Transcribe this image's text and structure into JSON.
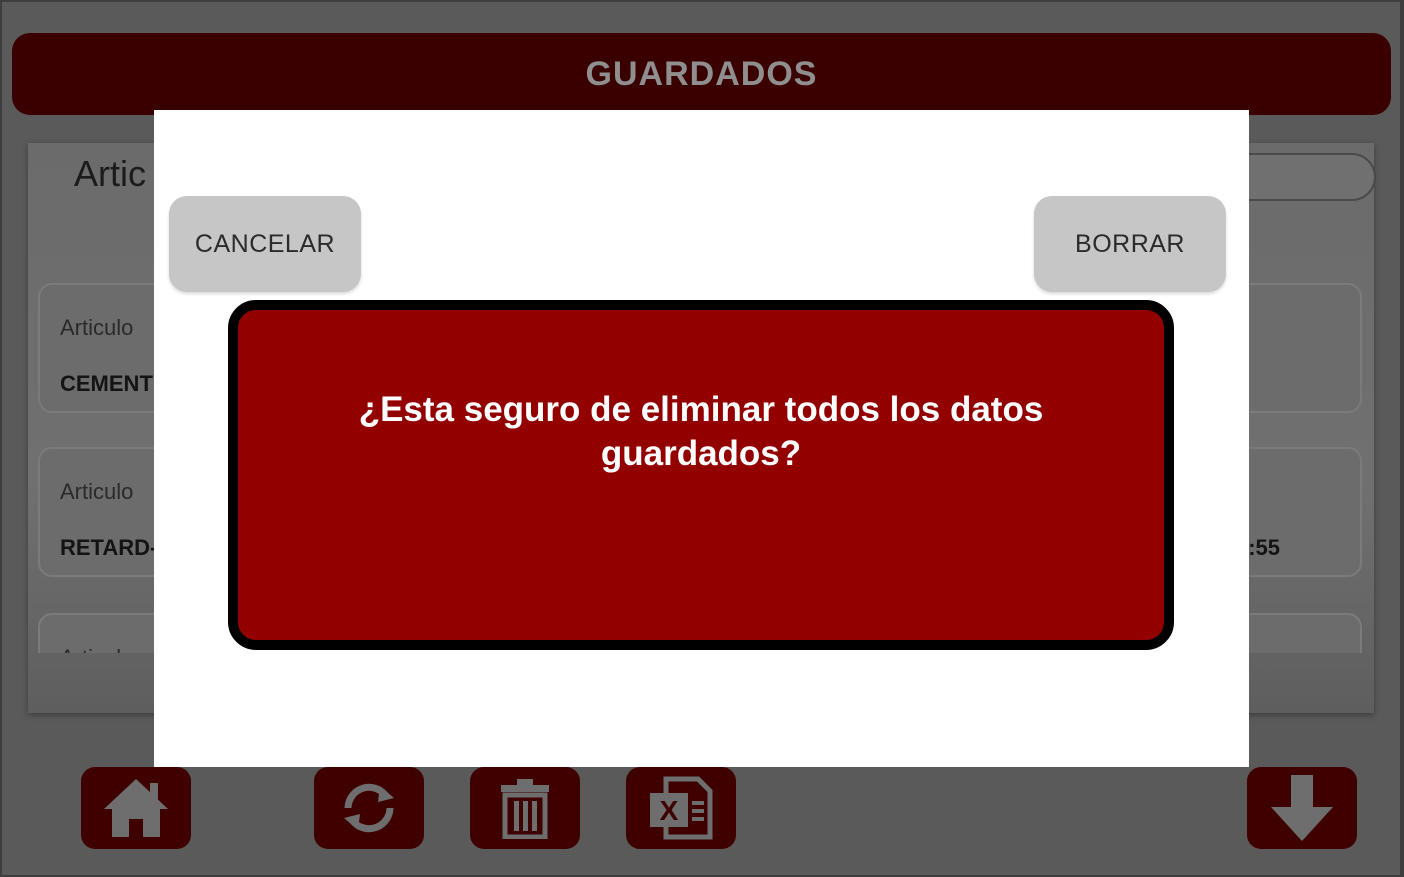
{
  "header": {
    "title": "GUARDADOS"
  },
  "panel": {
    "title": "Artic",
    "cards": [
      {
        "label": "Articulo",
        "value": "CEMENT",
        "right_value": ""
      },
      {
        "label": "Articulo",
        "value": "RETARD-",
        "right_value": ":55"
      },
      {
        "label": "Articulo",
        "value": "",
        "right_value": ""
      }
    ]
  },
  "dialog": {
    "cancel_label": "CANCELAR",
    "delete_label": "BORRAR",
    "message": "¿Esta seguro de eliminar todos los datos guardados?"
  },
  "toolbar": {
    "icons": [
      "home-icon",
      "refresh-icon",
      "trash-icon",
      "excel-icon",
      "download-arrow-icon"
    ]
  },
  "colors": {
    "header_bg": "#3a0000",
    "dialog_message_bg": "#930000",
    "button_gray": "#c6c6c6",
    "overlay": "#5a5a5a"
  }
}
